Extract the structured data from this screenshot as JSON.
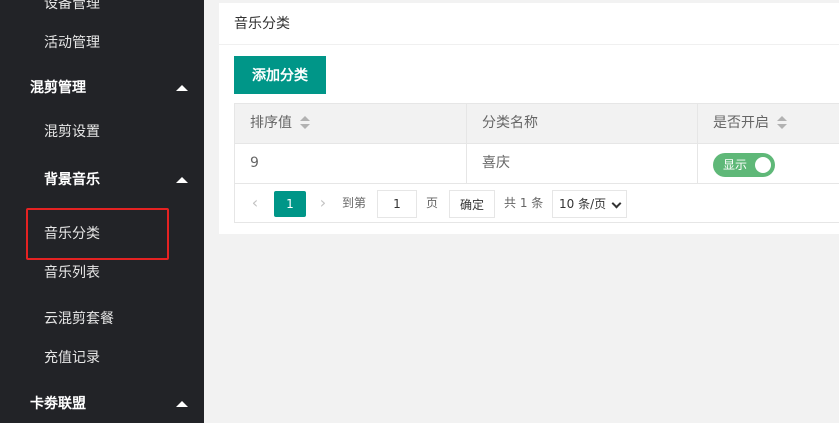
{
  "sidebar": {
    "items": [
      {
        "label": "设备管理",
        "type": "child"
      },
      {
        "label": "活动管理",
        "type": "child"
      },
      {
        "label": "混剪管理",
        "type": "group"
      },
      {
        "label": "混剪设置",
        "type": "child"
      },
      {
        "label": "背景音乐",
        "type": "sub-group"
      },
      {
        "label": "音乐分类",
        "type": "child",
        "highlighted": true
      },
      {
        "label": "音乐列表",
        "type": "child"
      },
      {
        "label": "云混剪套餐",
        "type": "child"
      },
      {
        "label": "充值记录",
        "type": "child"
      },
      {
        "label": "卡劵联盟",
        "type": "group"
      }
    ],
    "highlight_color": "#e52222",
    "background": "#222327"
  },
  "main": {
    "title": "音乐分类",
    "add_button": "添加分类",
    "accent": "#009688",
    "table": {
      "headers": [
        "排序值",
        "分类名称",
        "是否开启"
      ],
      "rows": [
        {
          "sort": "9",
          "name": "喜庆",
          "status": "显示",
          "enabled": true
        }
      ]
    },
    "pager": {
      "prev_icon": "chevron-left-icon",
      "next_icon": "chevron-right-icon",
      "current_page": "1",
      "goto_prefix": "到第",
      "goto_value": "1",
      "goto_suffix": "页",
      "confirm": "确定",
      "total": "共 1 条",
      "page_size": "10 条/页"
    }
  }
}
